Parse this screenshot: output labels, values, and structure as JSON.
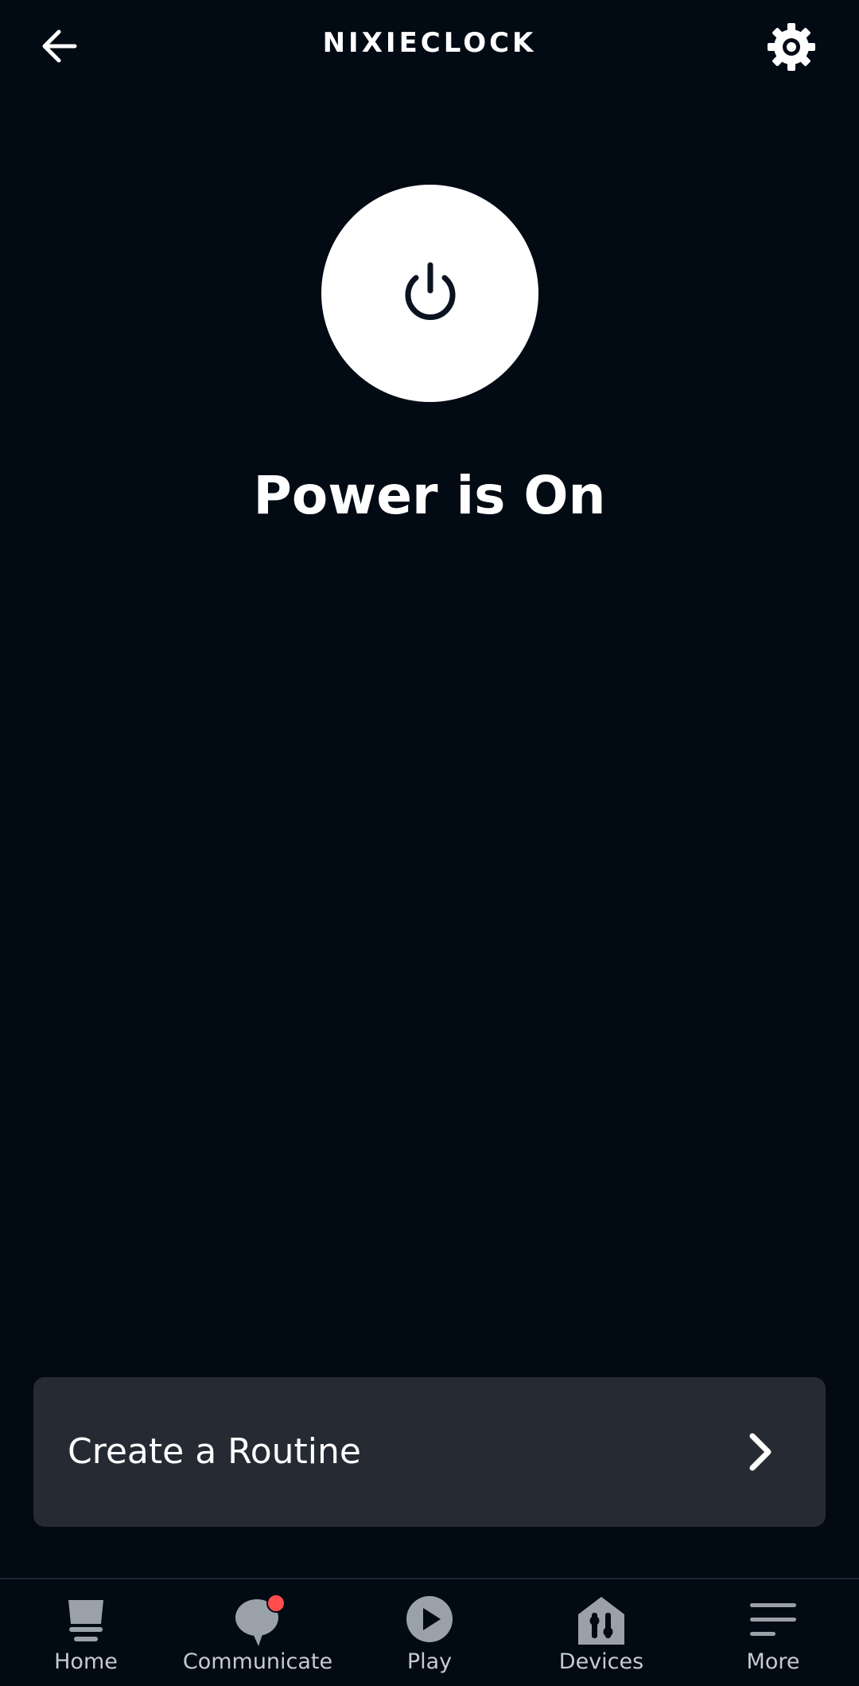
{
  "header": {
    "title": "NIXIECLOCK",
    "back_icon": "arrow-left-icon",
    "settings_icon": "gear-icon"
  },
  "power": {
    "icon": "power-icon",
    "status_text": "Power is On",
    "state": "on"
  },
  "routine": {
    "label": "Create a Routine",
    "icon": "chevron-right-icon"
  },
  "tabs": [
    {
      "label": "Home",
      "icon": "home-icon"
    },
    {
      "label": "Communicate",
      "icon": "chat-bubble-icon",
      "badge": true
    },
    {
      "label": "Play",
      "icon": "play-icon"
    },
    {
      "label": "Devices",
      "icon": "devices-icon"
    },
    {
      "label": "More",
      "icon": "menu-icon"
    }
  ],
  "colors": {
    "background": "#020a14",
    "card": "#262b33",
    "tab_icon": "#9aa1aa",
    "badge": "#ff4d4d"
  }
}
